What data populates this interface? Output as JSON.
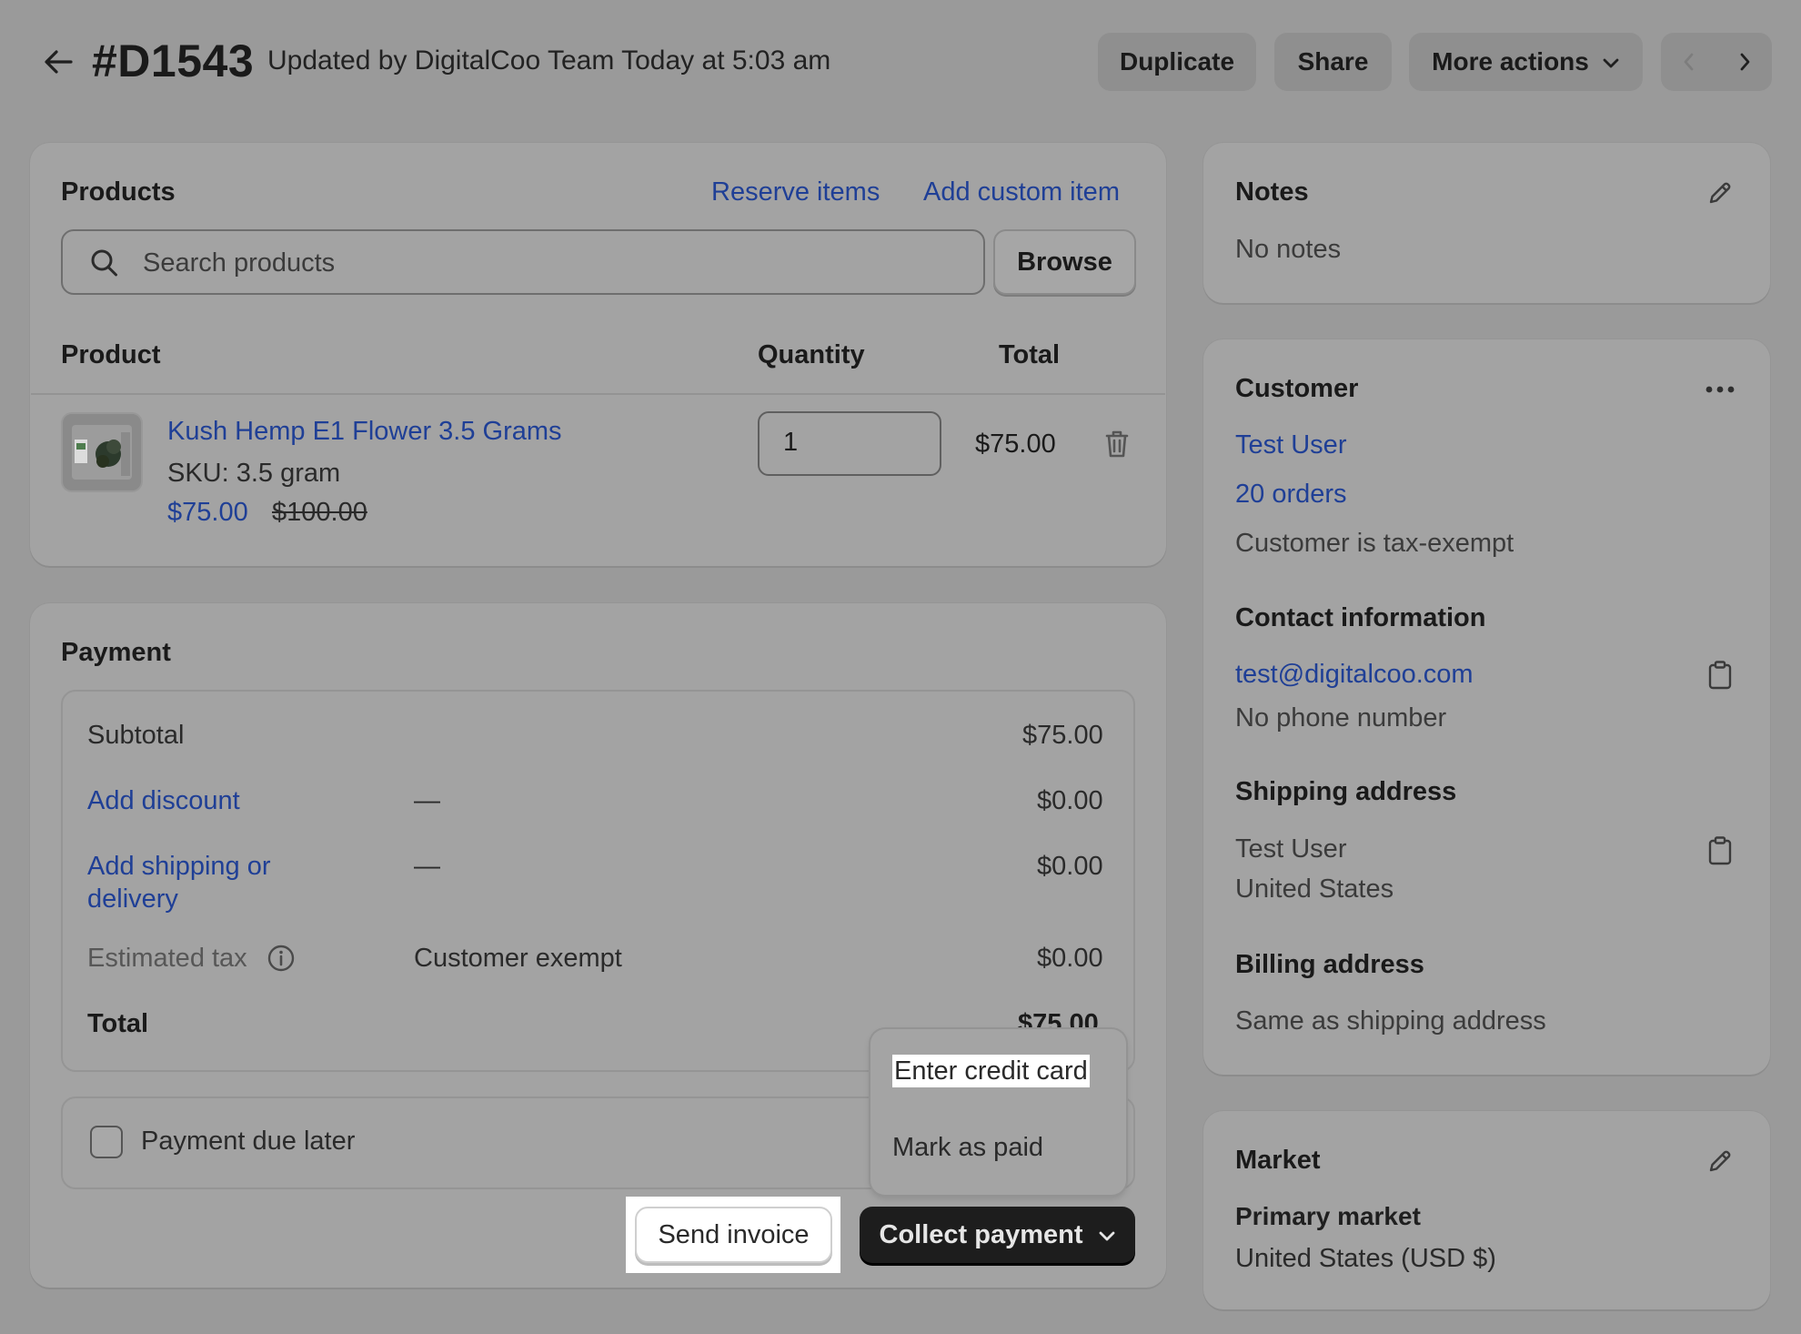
{
  "header": {
    "order_id": "#D1543",
    "subtitle": "Updated by DigitalCoo Team Today at 5:03 am",
    "duplicate_label": "Duplicate",
    "share_label": "Share",
    "more_actions_label": "More actions"
  },
  "products": {
    "title": "Products",
    "reserve_items_label": "Reserve items",
    "add_custom_item_label": "Add custom item",
    "search_placeholder": "Search products",
    "browse_label": "Browse",
    "columns": {
      "product": "Product",
      "quantity": "Quantity",
      "total": "Total"
    },
    "items": [
      {
        "name": "Kush Hemp E1 Flower 3.5 Grams",
        "sku": "SKU: 3.5 gram",
        "price": "$75.00",
        "compare_price": "$100.00",
        "quantity": "1",
        "total": "$75.00"
      }
    ]
  },
  "payment": {
    "title": "Payment",
    "subtotal_label": "Subtotal",
    "subtotal_value": "$75.00",
    "discount_label": "Add discount",
    "discount_dash": "—",
    "discount_value": "$0.00",
    "shipping_label_line1": "Add shipping or",
    "shipping_label_line2": "delivery",
    "shipping_dash": "—",
    "shipping_value": "$0.00",
    "tax_label": "Estimated tax",
    "tax_note": "Customer exempt",
    "tax_value": "$0.00",
    "total_label": "Total",
    "total_value": "$75.00",
    "due_later_label": "Payment due later",
    "send_invoice_label": "Send invoice",
    "collect_payment_label": "Collect payment",
    "menu": {
      "enter_credit_card": "Enter credit card",
      "mark_as_paid": "Mark as paid"
    }
  },
  "notes": {
    "title": "Notes",
    "text": "No notes"
  },
  "customer": {
    "title": "Customer",
    "name": "Test User",
    "orders": "20 orders",
    "tax_status": "Customer is tax-exempt",
    "contact_title": "Contact information",
    "email": "test@digitalcoo.com",
    "phone": "No phone number",
    "shipping_title": "Shipping address",
    "shipping_name": "Test User",
    "shipping_country": "United States",
    "billing_title": "Billing address",
    "billing_text": "Same as shipping address"
  },
  "market": {
    "title": "Market",
    "primary": "Primary market",
    "region": "United States (USD $)"
  },
  "icons": {
    "back": "arrow-left-icon",
    "search": "search-icon",
    "delete": "trash-icon",
    "edit": "pencil-icon",
    "more": "ellipsis-icon",
    "copy": "clipboard-icon",
    "info": "info-icon",
    "chevron": "chevron-down-icon"
  }
}
